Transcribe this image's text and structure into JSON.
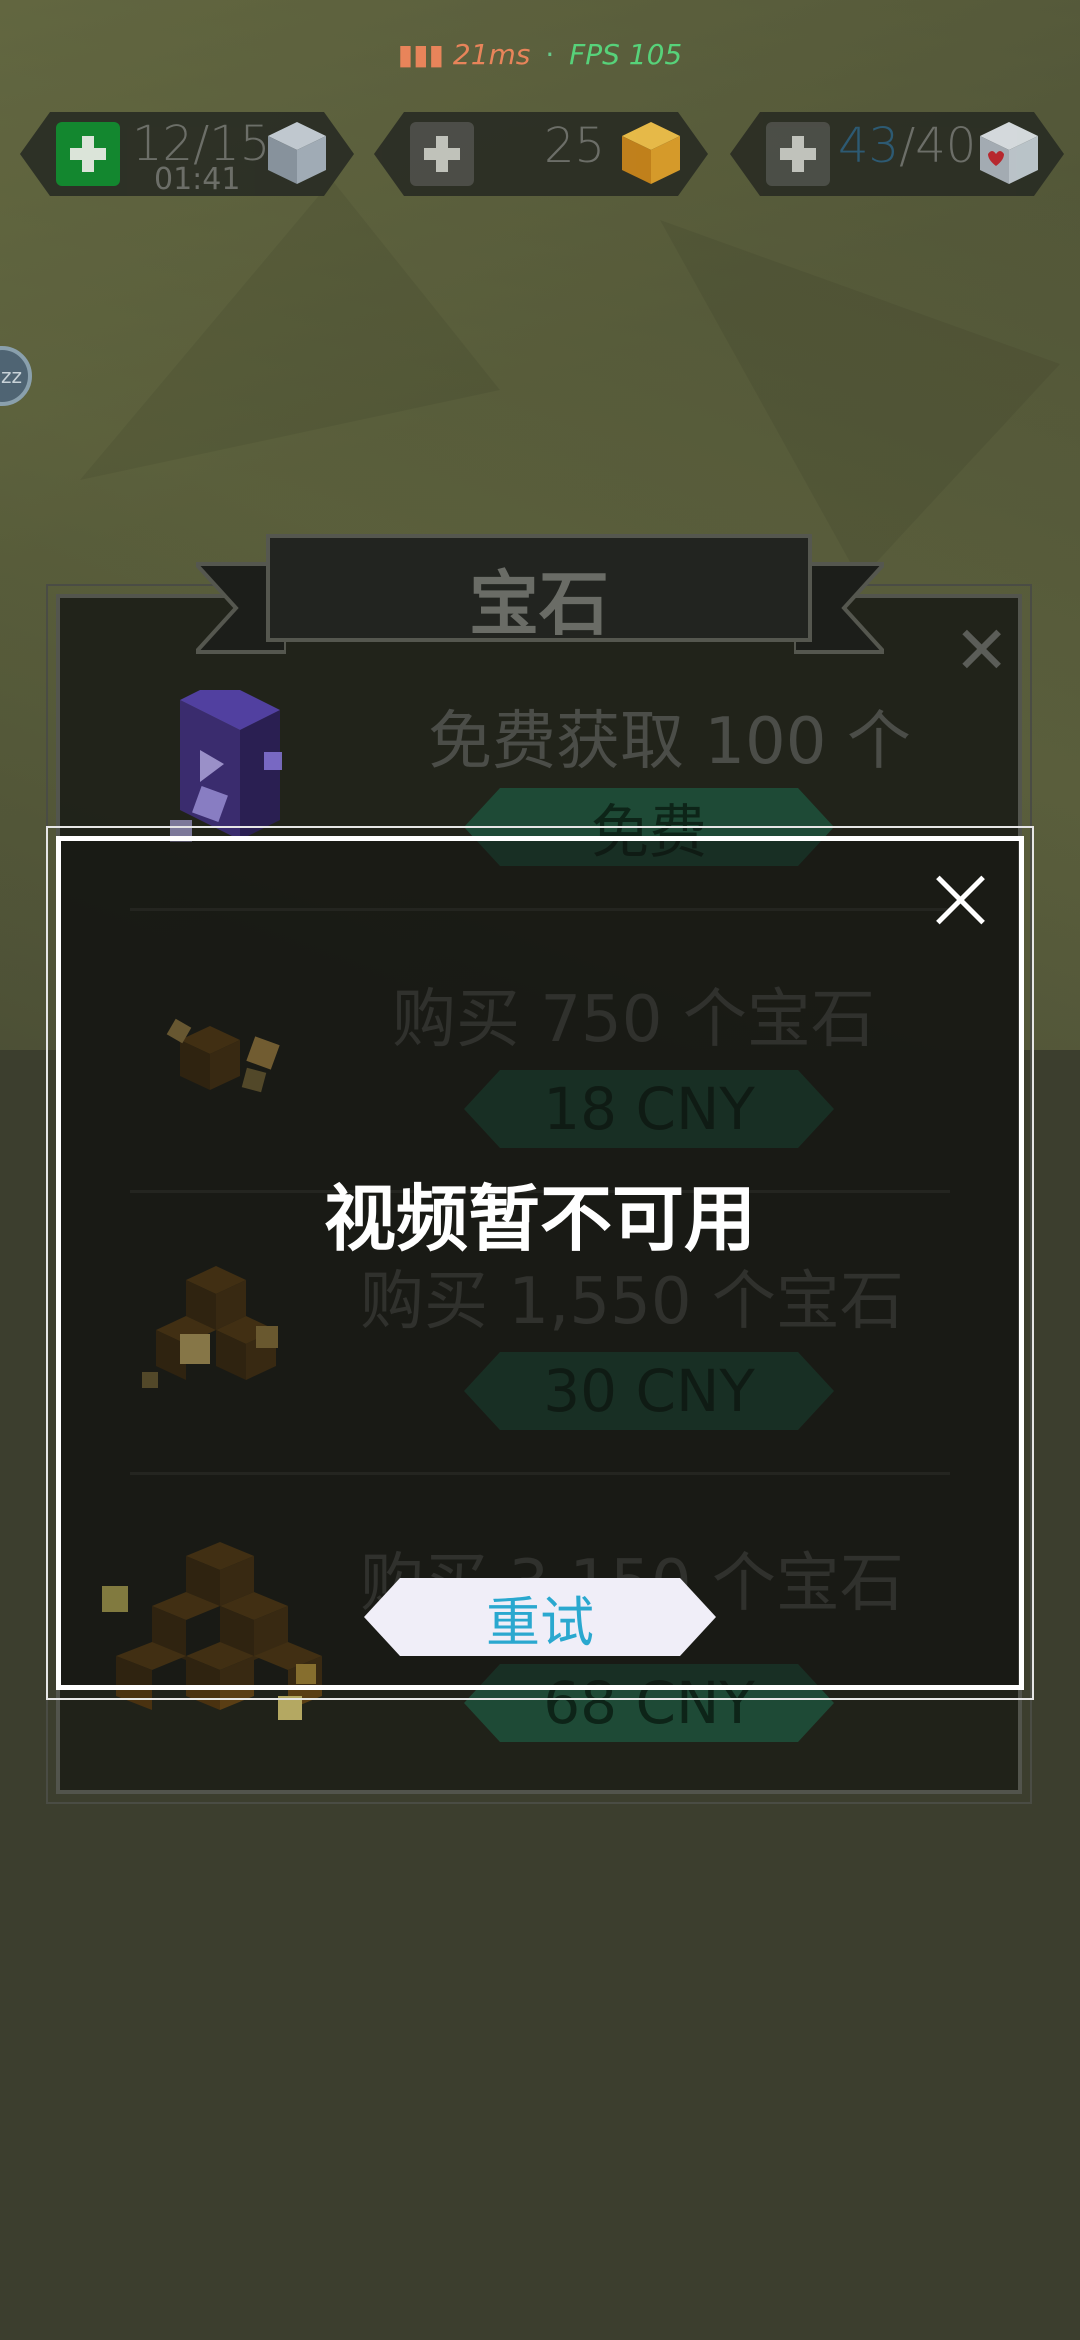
{
  "perf": {
    "latency": "21ms",
    "separator": "·",
    "fps": "FPS 105"
  },
  "resources": {
    "energy": {
      "value": "12/15",
      "timer": "01:41"
    },
    "gems": {
      "value": "25"
    },
    "hearts": {
      "current": "43",
      "max": "/40"
    }
  },
  "side_button": {
    "label": "zz"
  },
  "shop": {
    "title": "宝石",
    "rows": [
      {
        "title": "免费获取 100 个",
        "button": "免费"
      },
      {
        "title": "购买 750 个宝石",
        "button": "18 CNY"
      },
      {
        "title": "购买 1,550 个宝石",
        "button": "30 CNY"
      },
      {
        "title": "购买 3,150 个宝石",
        "button": "68 CNY"
      }
    ]
  },
  "dialog": {
    "message": "视频暂不可用",
    "retry_label": "重试"
  },
  "colors": {
    "fps": "#57d27a",
    "latency": "#e8845a",
    "retry_text": "#2aa8cf",
    "energy_plus": "#0e8a2e",
    "hearts_current": "#2aa8cf"
  }
}
